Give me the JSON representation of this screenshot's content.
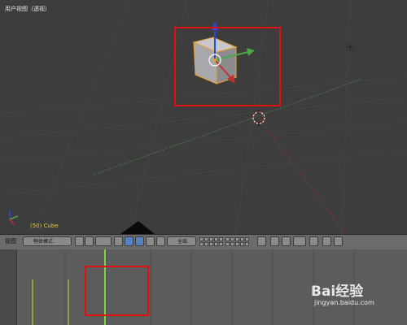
{
  "viewport": {
    "title": "用户视图（透视）",
    "object_label": "(50) Cube"
  },
  "header": {
    "view_menu": "视图",
    "mode_dropdown": "物体模式",
    "transform_dropdown": "全局"
  },
  "timeline": {
    "current_frame": 50
  },
  "watermark": {
    "logo": "Bai经验",
    "url": "jingyan.baidu.com"
  },
  "colors": {
    "selection_box": "#e01010",
    "axis_x": "#c03030",
    "axis_y": "#4aa84a",
    "axis_z": "#2a4ad8",
    "playhead": "#7fd640",
    "keyframe": "#d8d820",
    "object_label": "#e0c840"
  }
}
